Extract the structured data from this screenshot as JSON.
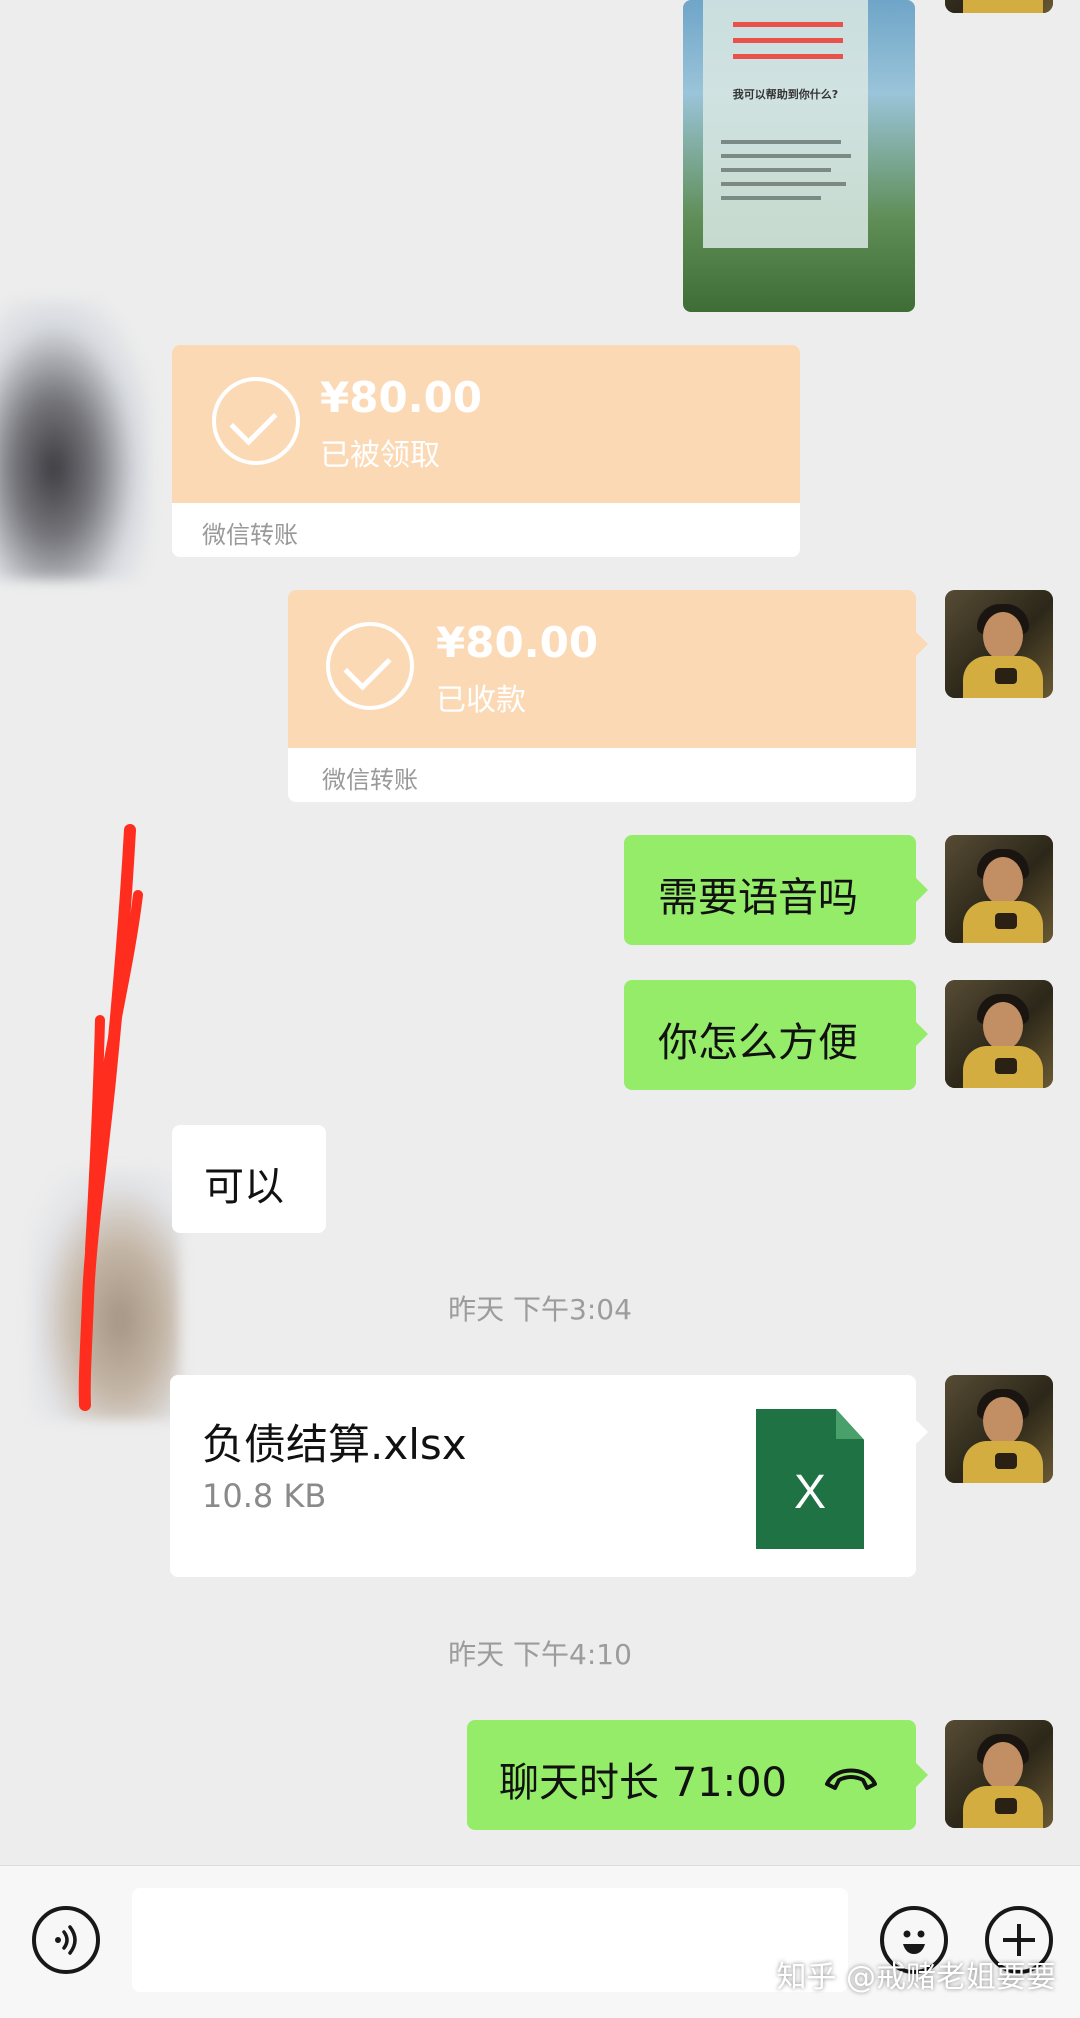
{
  "transfers": [
    {
      "amount": "¥80.00",
      "status": "已被领取",
      "label": "微信转账"
    },
    {
      "amount": "¥80.00",
      "status": "已收款",
      "label": "微信转账"
    }
  ],
  "messages": {
    "voice_question": "需要语音吗",
    "convenience": "你怎么方便",
    "reply_ok": "可以"
  },
  "timestamps": [
    "昨天 下午3:04",
    "昨天 下午4:10"
  ],
  "file": {
    "name": "负债结算.xlsx",
    "size": "10.8 KB",
    "icon_letter": "X"
  },
  "call": {
    "text": "聊天时长 71:00"
  },
  "image_card": {
    "heading": "我可以帮助到你什么?"
  },
  "watermark": "知乎 @戒赌老姐要要",
  "icons": {
    "voice": "voice-input-icon",
    "emoji": "emoji-icon",
    "add": "add-icon",
    "phone": "phone-hangup-icon",
    "check": "check-circle-icon",
    "excel": "excel-file-icon"
  },
  "colors": {
    "chat_bg": "#ededed",
    "green_bubble": "#95ec69",
    "transfer_orange": "#fbd9b5",
    "excel_green": "#1f7244",
    "annotation_red": "#ff2d1e"
  }
}
